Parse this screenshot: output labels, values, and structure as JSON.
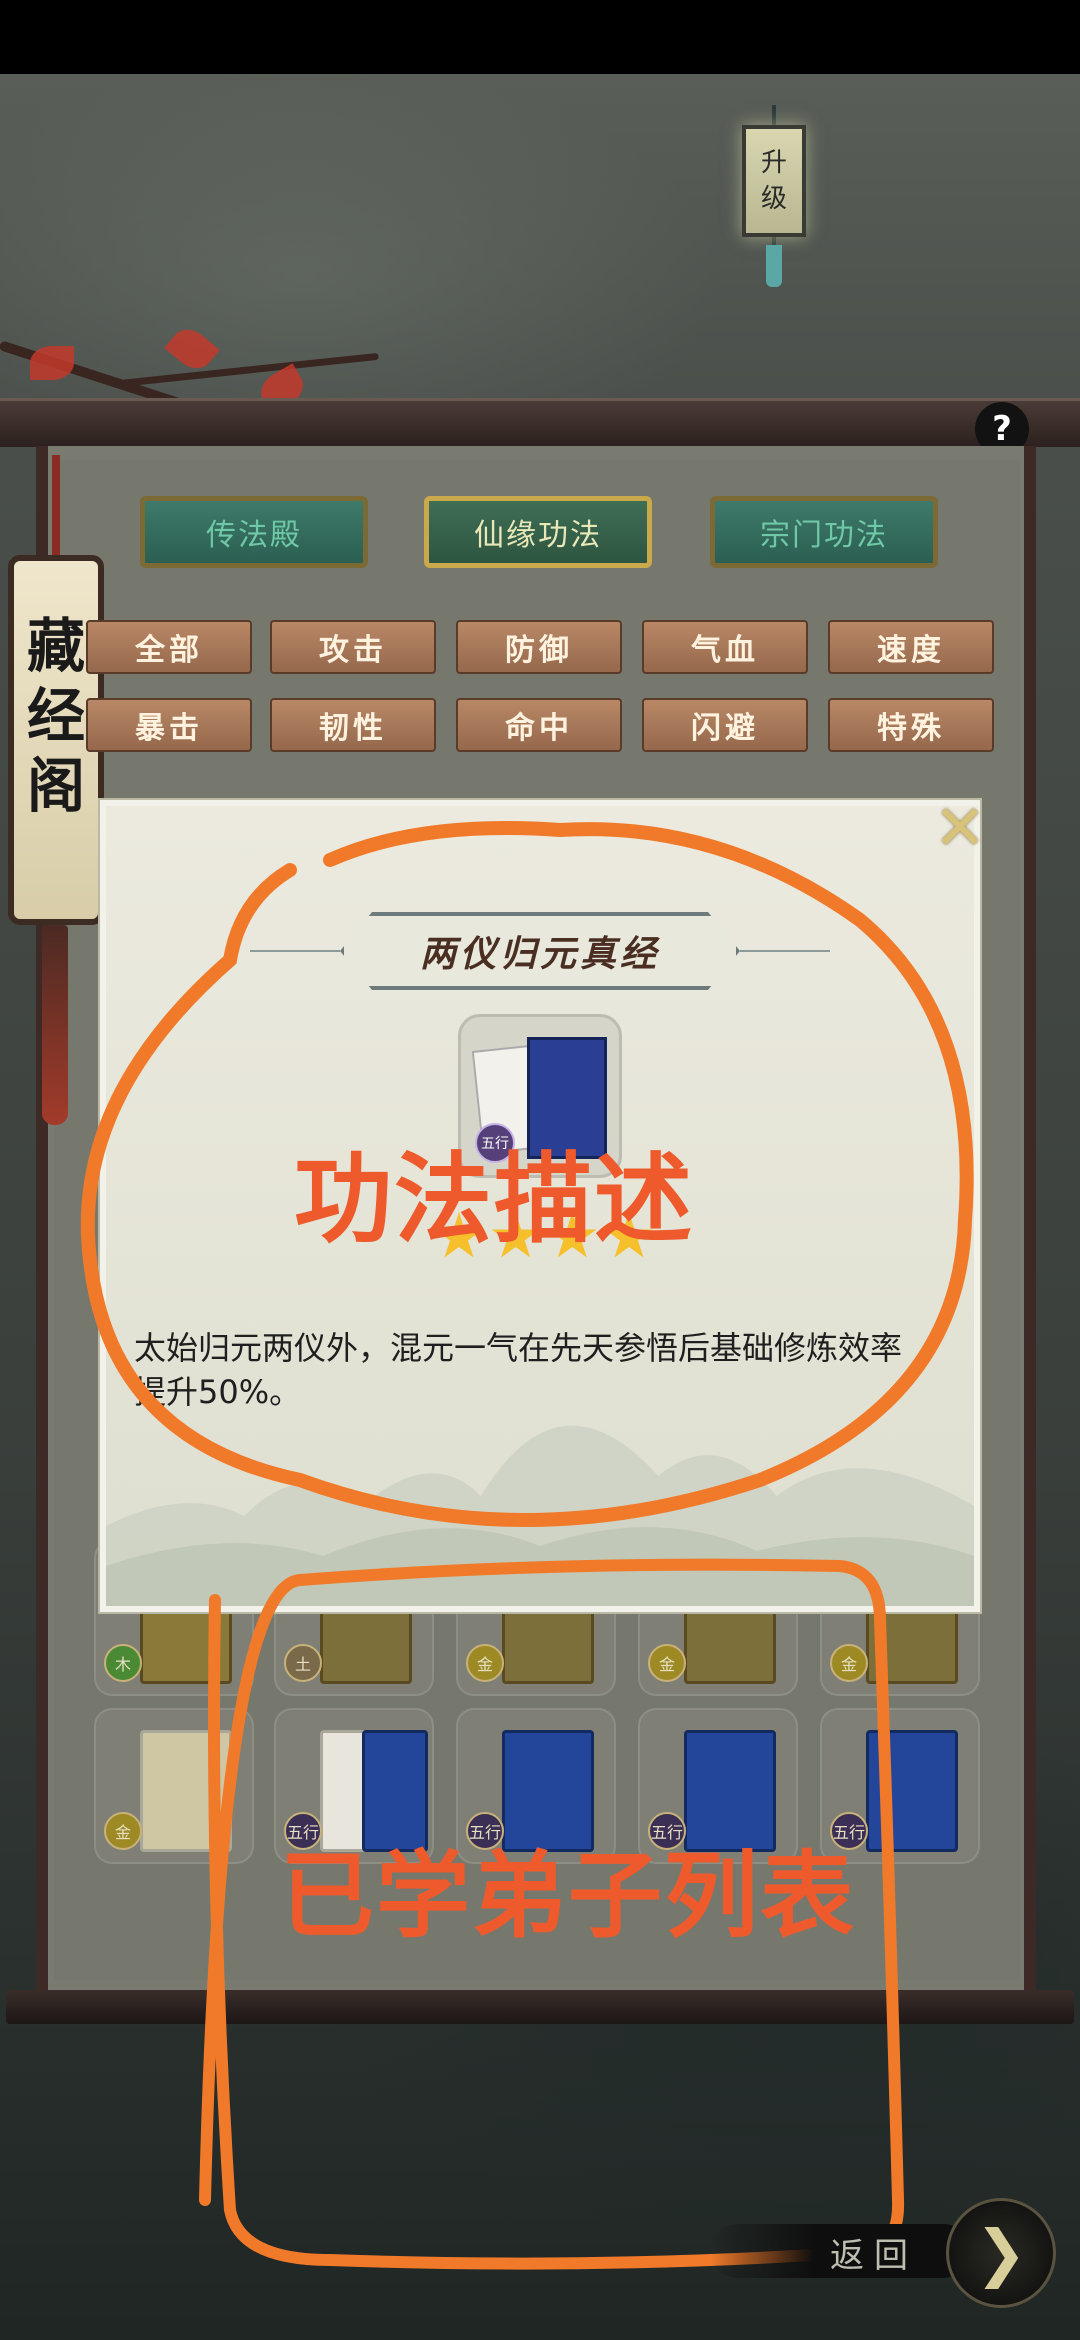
{
  "upgrade_sign": {
    "chars": [
      "升",
      "级"
    ]
  },
  "help_button": {
    "label": "?"
  },
  "side_banner": {
    "chars": [
      "藏",
      "经",
      "阁"
    ]
  },
  "tabs": [
    {
      "label": "传法殿",
      "active": false
    },
    {
      "label": "仙缘功法",
      "active": true
    },
    {
      "label": "宗门功法",
      "active": false
    }
  ],
  "filters_row1": [
    "全部",
    "攻击",
    "防御",
    "气血",
    "速度"
  ],
  "filters_row2": [
    "暴击",
    "韧性",
    "命中",
    "闪避",
    "特殊"
  ],
  "grid_row1_badges": [
    "木",
    "土",
    "金",
    "金",
    "金"
  ],
  "grid_row2_badges": [
    "金",
    "五行",
    "五行",
    "五行",
    "五行"
  ],
  "modal": {
    "title": "两仪归元真经",
    "grade_badge": "五行",
    "star_count": 4,
    "description": "太始归元两仪外，混元一气在先天参悟后基础修炼效率提升50%。"
  },
  "annotations": {
    "top_label": "功法描述",
    "bottom_label": "已学弟子列表",
    "color": "#ee5a2c"
  },
  "back_button": {
    "label": "返回",
    "arrow": "❯"
  },
  "colors": {
    "tab_active_text": "#e9e8b8",
    "star": "#f5c02b",
    "annotation": "#ee5a2c"
  }
}
